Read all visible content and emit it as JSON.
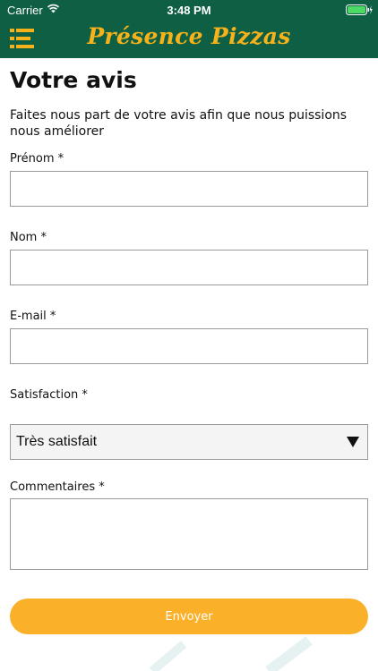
{
  "status_bar": {
    "carrier": "Carrier",
    "time": "3:48 PM",
    "wifi_icon": "wifi-icon",
    "battery_icon": "battery-charging-icon"
  },
  "header": {
    "brand": "Présence Pizzas",
    "menu_icon": "hamburger-menu-icon",
    "background_color": "#0f5f45",
    "brand_color": "#f5b21a"
  },
  "page": {
    "title": "Votre avis",
    "intro": "Faites nous part de votre avis afin que nous puissions nous améliorer"
  },
  "form": {
    "prenom_label": "Prénom *",
    "prenom_value": "",
    "nom_label": "Nom *",
    "nom_value": "",
    "email_label": "E-mail *",
    "email_value": "",
    "satisfaction_label": "Satisfaction *",
    "satisfaction_value": "Très satisfait",
    "commentaires_label": "Commentaires *",
    "commentaires_value": "",
    "submit_label": "Envoyer",
    "submit_color": "#fbb029"
  }
}
